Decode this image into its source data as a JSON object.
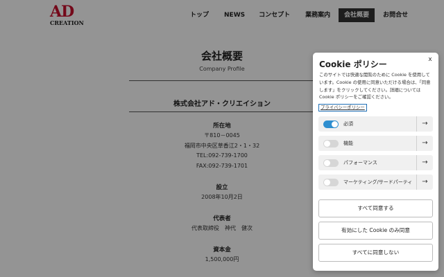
{
  "logo": {
    "top": "AD",
    "bottom": "CREATION"
  },
  "nav": {
    "items": [
      {
        "label": "トップ"
      },
      {
        "label": "NEWS"
      },
      {
        "label": "コンセプト"
      },
      {
        "label": "業務案内"
      },
      {
        "label": "会社概要",
        "active": true
      },
      {
        "label": "お問合せ"
      }
    ]
  },
  "main": {
    "title": "会社概要",
    "subtitle": "Company Profile",
    "company_name": "株式会社アド・クリエイション",
    "address": {
      "label": "所在地",
      "lines": [
        "〒810－0045",
        "福岡市中央区草香江2・1・32",
        "TEL:092-739-1700",
        "FAX:092-739-1701"
      ]
    },
    "established": {
      "label": "設立",
      "value": "2008年10月2日"
    },
    "representative": {
      "label": "代表者",
      "value": "代表取締役　神代　健次"
    },
    "capital": {
      "label": "資本金",
      "value": "1,500,000円"
    }
  },
  "cookie": {
    "title": "Cookie ポリシー",
    "close_label": "x",
    "description": "このサイトでは快適な閲覧のために Cookie を使用しています。Cookie の使用に同意いただける場合は、「同意します」をクリックしてください。詳細については Cookie ポリシーをご確認ください。",
    "privacy_link": "プライバシーポリシー",
    "categories": [
      {
        "label": "必須",
        "enabled": true
      },
      {
        "label": "機能",
        "enabled": false
      },
      {
        "label": "パフォーマンス",
        "enabled": false
      },
      {
        "label": "マーケティング/サードパーティ",
        "enabled": false
      }
    ],
    "arrow_glyph": "→",
    "buttons": {
      "accept_all": "すべて同意する",
      "accept_selected": "有効にした Cookie のみ同意",
      "reject_all": "すべてに同意しない"
    },
    "colors": {
      "toggle_on": "#2f8fd0",
      "link_border": "#1f6fb5"
    }
  }
}
